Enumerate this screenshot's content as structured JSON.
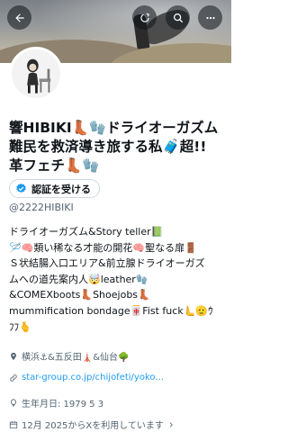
{
  "profile": {
    "name_line1": "響HIBIKI👢🧤ドライオーガズム",
    "name_line2": "難民を救済導き旅する私🧳超!!",
    "name_line3": "革フェチ👢🧤",
    "verify_button_label": "認証を受ける",
    "handle": "@2222HIBIKI",
    "bio": [
      "ドライオーガズム&Story teller📗",
      "🪡🧠類い稀なる才能の開花🧠聖なる扉🚪",
      "Ｓ状結腸入口エリア&前立腺ドライオーガズ",
      "ムへの道先案内人🤯leather🧤",
      "&COMEXboots👢Shoejobs👢",
      "mummification bondage🀄Fist fuck🫷🫡ｳ",
      "ﾌﾌ🫰"
    ],
    "location": "横浜⚓&五反田🗼&仙台🌳",
    "website": "star-group.co.jp/chijofeti/yoko...",
    "birthday": "生年月日: 1979 5 3",
    "joined": "12月 2025からXを利用しています"
  },
  "colors": {
    "accent": "#1d9bf0",
    "secondary_text": "#536471",
    "primary_text": "#0f1419"
  },
  "icons": {
    "back": "arrow-left-icon",
    "refresh": "refresh-icon",
    "search": "search-icon",
    "more": "more-icon",
    "verify": "verified-badge-icon",
    "location": "location-pin-icon",
    "link": "link-icon",
    "birthday": "balloon-icon",
    "calendar": "calendar-icon"
  }
}
